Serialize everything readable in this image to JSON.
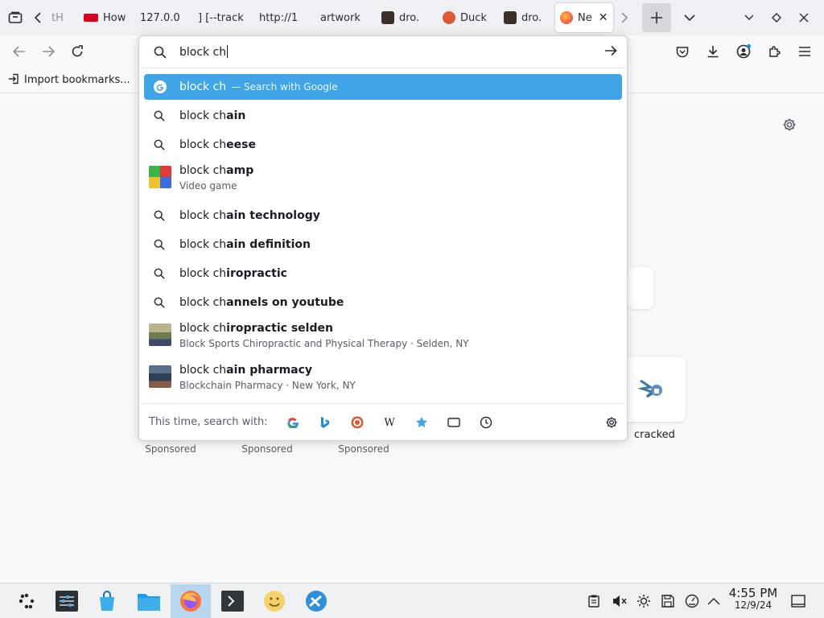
{
  "tabs": [
    {
      "label": "tH",
      "favicon": "none"
    },
    {
      "label": "How",
      "favicon": "red-badge"
    },
    {
      "label": "127.0.0",
      "favicon": "none"
    },
    {
      "label": "] [--track",
      "favicon": "none"
    },
    {
      "label": "http://1",
      "favicon": "none"
    },
    {
      "label": "artwork",
      "favicon": "none"
    },
    {
      "label": "dro.",
      "favicon": "dark-thumb"
    },
    {
      "label": "Duck",
      "favicon": "duckduckgo"
    },
    {
      "label": "dro.",
      "favicon": "dark-thumb"
    },
    {
      "label": "Ne",
      "favicon": "firefox",
      "active": true
    }
  ],
  "bookmarks": {
    "import_label": "Import bookmarks..."
  },
  "urlbar": {
    "value": "block ch"
  },
  "suggestions": [
    {
      "typed": "block ch",
      "completion": "",
      "hint": "— Search with Google",
      "icon": "google-icon",
      "selected": true
    },
    {
      "typed": "block ch",
      "completion": "ain",
      "icon": "search-icon"
    },
    {
      "typed": "block ch",
      "completion": "eese",
      "icon": "search-icon"
    },
    {
      "typed": "block ch",
      "completion": "amp",
      "desc": "Video game",
      "icon": "tetris-thumb"
    },
    {
      "typed": "block ch",
      "completion": "ain technology",
      "icon": "search-icon"
    },
    {
      "typed": "block ch",
      "completion": "ain definition",
      "icon": "search-icon"
    },
    {
      "typed": "block ch",
      "completion": "iropractic",
      "icon": "search-icon"
    },
    {
      "typed": "block ch",
      "completion": "annels on youtube",
      "icon": "search-icon"
    },
    {
      "typed": "block ch",
      "completion": "iropractic selden",
      "desc": "Block Sports Chiropractic and Physical Therapy · Selden, NY",
      "icon": "clinic-thumb"
    },
    {
      "typed": "block ch",
      "completion": "ain pharmacy",
      "desc": "Blockchain Pharmacy · New York, NY",
      "icon": "pharmacy-thumb"
    }
  ],
  "oneoff": {
    "label": "This time, search with:",
    "engines": [
      "google-icon",
      "bing-icon",
      "duckduckgo-icon",
      "wikipedia-icon",
      "bookmarks-star-icon",
      "tabs-icon",
      "history-icon"
    ],
    "wiki_glyph": "W"
  },
  "page": {
    "sponsored": [
      "Sponsored",
      "Sponsored",
      "Sponsored"
    ],
    "tile_cracked": "cracked"
  },
  "taskbar": {
    "time": "4:55 PM",
    "date": "12/9/24"
  },
  "colors": {
    "highlight": "#3fa5e6",
    "taskbar_active": "#b8d7ee"
  }
}
